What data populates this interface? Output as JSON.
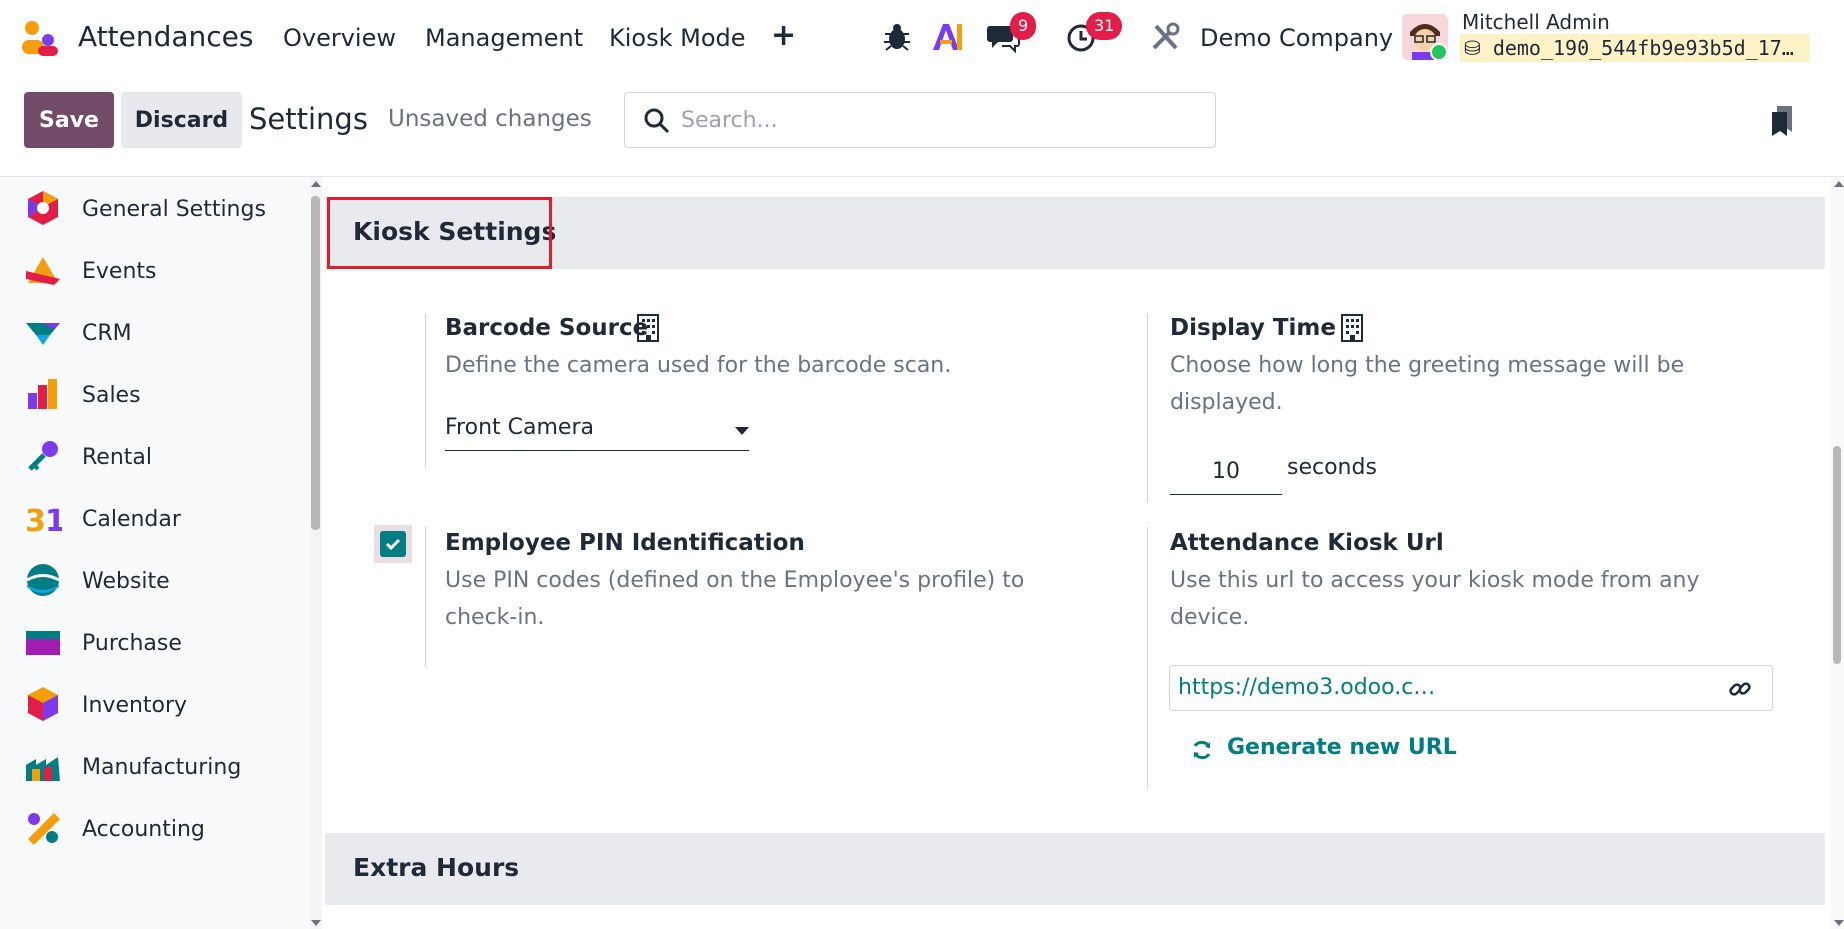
{
  "navbar": {
    "app_name": "Attendances",
    "menu": [
      "Overview",
      "Management",
      "Kiosk Mode"
    ],
    "plus": "+",
    "messages_count": "9",
    "activities_count": "31",
    "company": "Demo Company",
    "user_name": "Mitchell Admin",
    "database": "demo_190_544fb9e93b5d_17…"
  },
  "control_panel": {
    "save_label": "Save",
    "discard_label": "Discard",
    "title": "Settings",
    "status": "Unsaved changes",
    "search_placeholder": "Search..."
  },
  "sidebar": {
    "items": [
      {
        "label": "General Settings",
        "icon": "general-settings-icon"
      },
      {
        "label": "Events",
        "icon": "events-icon"
      },
      {
        "label": "CRM",
        "icon": "crm-icon"
      },
      {
        "label": "Sales",
        "icon": "sales-icon"
      },
      {
        "label": "Rental",
        "icon": "rental-icon"
      },
      {
        "label": "Calendar",
        "icon": "calendar-icon"
      },
      {
        "label": "Website",
        "icon": "website-icon"
      },
      {
        "label": "Purchase",
        "icon": "purchase-icon"
      },
      {
        "label": "Inventory",
        "icon": "inventory-icon"
      },
      {
        "label": "Manufacturing",
        "icon": "manufacturing-icon"
      },
      {
        "label": "Accounting",
        "icon": "accounting-icon"
      }
    ]
  },
  "kiosk": {
    "section_title": "Kiosk Settings",
    "barcode_source": {
      "title": "Barcode Source",
      "description": "Define the camera used for the barcode scan.",
      "value": "Front Camera"
    },
    "display_time": {
      "title": "Display Time",
      "description": "Choose how long the greeting message will be displayed.",
      "value": "10",
      "suffix": "seconds"
    },
    "pin": {
      "title": "Employee PIN Identification",
      "description": "Use PIN codes (defined on the Employee's profile) to check-in.",
      "checked": true
    },
    "kiosk_url": {
      "title": "Attendance Kiosk Url",
      "description": "Use this url to access your kiosk mode from any device.",
      "url": "https://demo3.odoo.c…",
      "generate_label": "Generate new URL"
    }
  },
  "extra_hours": {
    "section_title": "Extra Hours"
  },
  "colors": {
    "primary": "#714b67",
    "accent": "#017e84",
    "badge": "#e11d48",
    "highlight": "#e11d2a"
  }
}
